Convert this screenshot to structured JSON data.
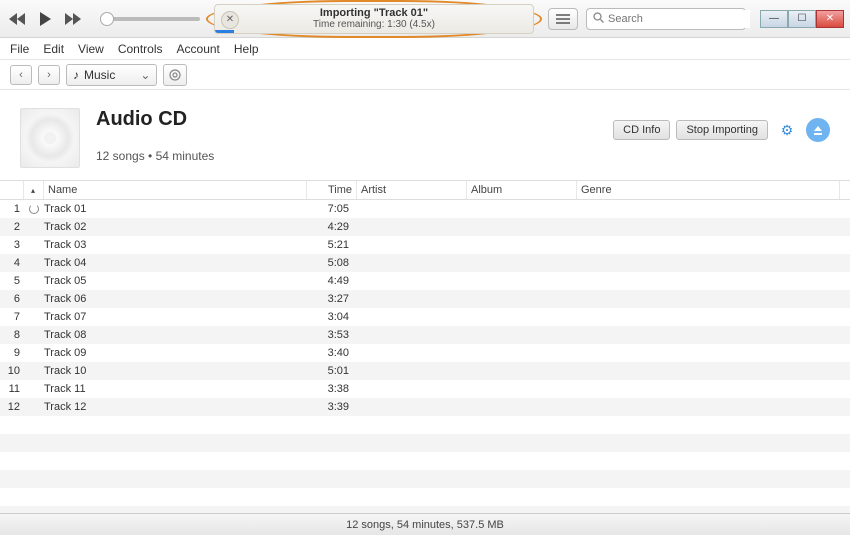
{
  "lcd": {
    "title": "Importing \"Track 01\"",
    "subtitle": "Time remaining: 1:30 (4.5x)"
  },
  "search": {
    "placeholder": "Search"
  },
  "menu": {
    "file": "File",
    "edit": "Edit",
    "view": "View",
    "controls": "Controls",
    "account": "Account",
    "help": "Help"
  },
  "nav": {
    "dropdown_label": "Music"
  },
  "header": {
    "title": "Audio CD",
    "meta": "12 songs • 54 minutes",
    "cd_info": "CD Info",
    "stop_importing": "Stop Importing"
  },
  "columns": {
    "name": "Name",
    "time": "Time",
    "artist": "Artist",
    "album": "Album",
    "genre": "Genre"
  },
  "tracks": [
    {
      "num": "1",
      "name": "Track 01",
      "time": "7:05",
      "importing": true
    },
    {
      "num": "2",
      "name": "Track 02",
      "time": "4:29",
      "importing": false
    },
    {
      "num": "3",
      "name": "Track 03",
      "time": "5:21",
      "importing": false
    },
    {
      "num": "4",
      "name": "Track 04",
      "time": "5:08",
      "importing": false
    },
    {
      "num": "5",
      "name": "Track 05",
      "time": "4:49",
      "importing": false
    },
    {
      "num": "6",
      "name": "Track 06",
      "time": "3:27",
      "importing": false
    },
    {
      "num": "7",
      "name": "Track 07",
      "time": "3:04",
      "importing": false
    },
    {
      "num": "8",
      "name": "Track 08",
      "time": "3:53",
      "importing": false
    },
    {
      "num": "9",
      "name": "Track 09",
      "time": "3:40",
      "importing": false
    },
    {
      "num": "10",
      "name": "Track 10",
      "time": "5:01",
      "importing": false
    },
    {
      "num": "11",
      "name": "Track 11",
      "time": "3:38",
      "importing": false
    },
    {
      "num": "12",
      "name": "Track 12",
      "time": "3:39",
      "importing": false
    }
  ],
  "status": "12 songs, 54 minutes, 537.5 MB"
}
